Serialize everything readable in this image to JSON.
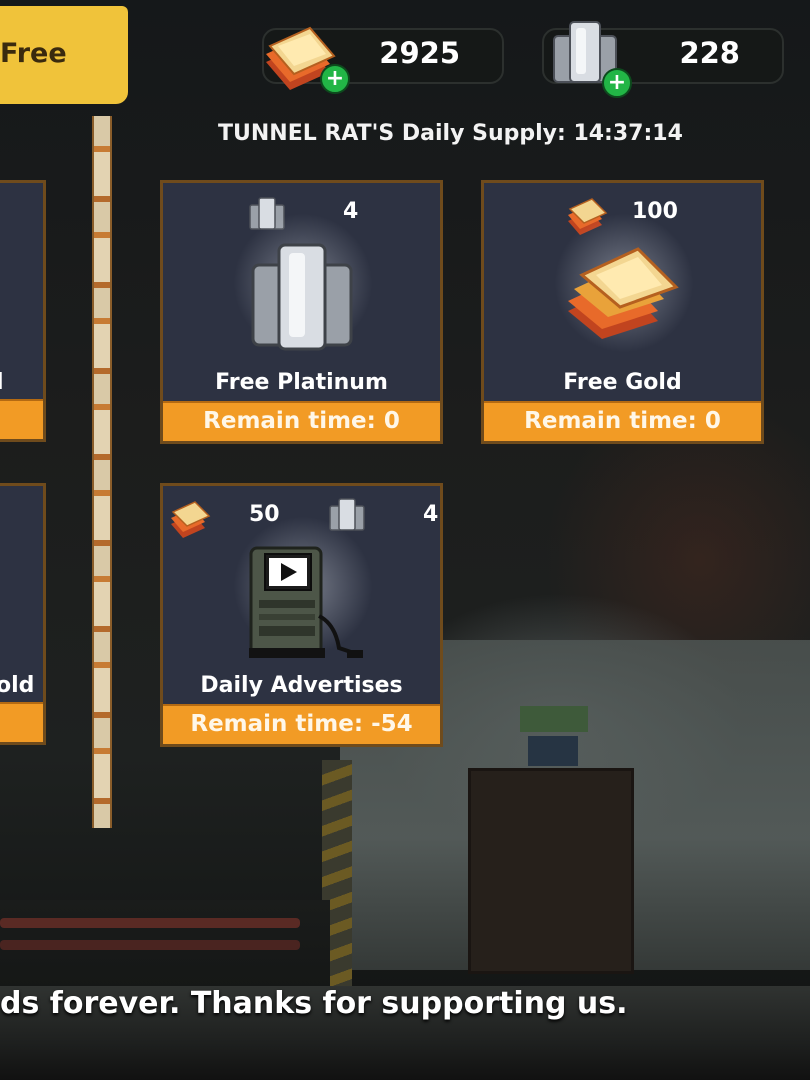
{
  "tab": {
    "label": "Free"
  },
  "resources": {
    "gold": "2925",
    "platinum": "228"
  },
  "supply_title": "TUNNEL RAT'S Daily Supply: 14:37:14",
  "left_cards": {
    "top_name": "l",
    "bottom_name": "old"
  },
  "cards": [
    {
      "name": "Free Platinum",
      "reward_platinum": "4",
      "remain": "Remain time: 0"
    },
    {
      "name": "Free Gold",
      "reward_gold": "100",
      "remain": "Remain time: 0"
    },
    {
      "name": "Daily Advertises",
      "reward_gold": "50",
      "reward_platinum": "4",
      "remain": "Remain time: -54"
    }
  ],
  "footer": "ds forever. Thanks for supporting us.",
  "colors": {
    "accent": "#f29b25",
    "tab": "#f0c33a",
    "card": "#2d3242",
    "plus": "#22b546"
  }
}
